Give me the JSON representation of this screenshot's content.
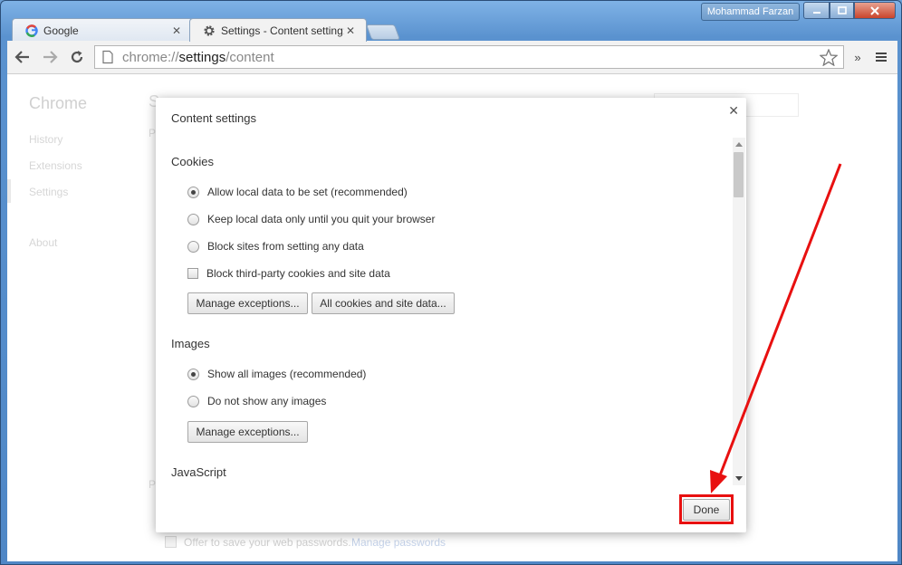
{
  "window": {
    "user_name": "Mohammad Farzan"
  },
  "tabs": [
    {
      "title": "Google",
      "active": false
    },
    {
      "title": "Settings - Content setting:",
      "active": true
    }
  ],
  "toolbar": {
    "url_scheme": "chrome://",
    "url_host": "settings",
    "url_path": "/content"
  },
  "page": {
    "side_title": "Chrome",
    "side_items": [
      "History",
      "Extensions",
      "Settings",
      "About"
    ],
    "ghost_heading": "S",
    "ghost_p1": "P",
    "ghost_p2": "P",
    "ghost_password_text": "Offer to save your web passwords.",
    "ghost_password_link": "Manage passwords"
  },
  "dialog": {
    "title": "Content settings",
    "close_glyph": "✕",
    "sections": {
      "cookies": {
        "title": "Cookies",
        "options": [
          {
            "label": "Allow local data to be set (recommended)",
            "selected": true
          },
          {
            "label": "Keep local data only until you quit your browser",
            "selected": false
          },
          {
            "label": "Block sites from setting any data",
            "selected": false
          }
        ],
        "checkbox_label": "Block third-party cookies and site data",
        "button_manage": "Manage exceptions...",
        "button_all": "All cookies and site data..."
      },
      "images": {
        "title": "Images",
        "options": [
          {
            "label": "Show all images (recommended)",
            "selected": true
          },
          {
            "label": "Do not show any images",
            "selected": false
          }
        ],
        "button_manage": "Manage exceptions..."
      },
      "javascript": {
        "title": "JavaScript"
      }
    },
    "done_label": "Done"
  },
  "colors": {
    "annotation": "#e81010",
    "accent_frame": "#5a92cf"
  },
  "icons": {
    "back": "arrow-left-icon",
    "forward": "arrow-right-icon",
    "reload": "reload-icon",
    "star": "star-icon",
    "menu": "hamburger-menu-icon",
    "overflow": "double-chevron-icon",
    "google_favicon": "google-g-icon",
    "settings_favicon": "gear-icon"
  }
}
